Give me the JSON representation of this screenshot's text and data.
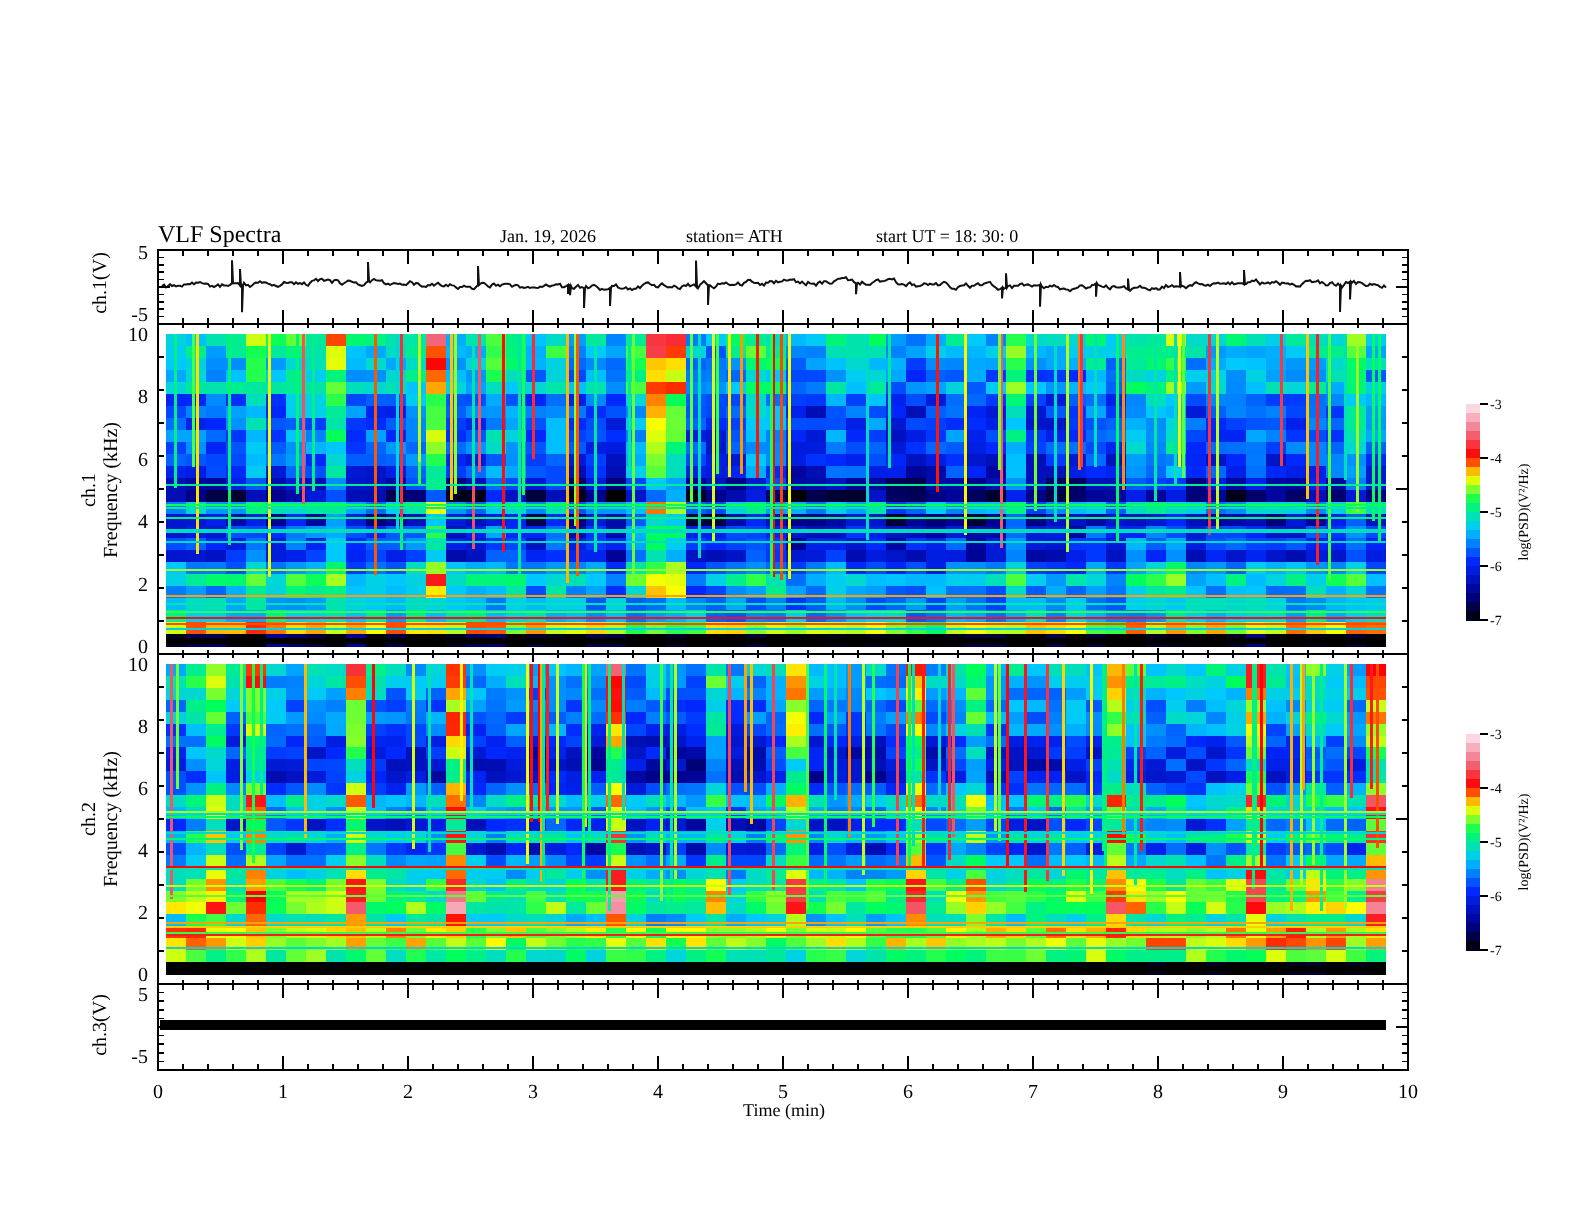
{
  "header": {
    "title": "VLF  Spectra",
    "date": "Jan.  19,  2026",
    "station": "station= ATH",
    "start": "start  UT  =   18: 30: 0"
  },
  "panels": [
    {
      "kind": "waveform",
      "ylabel": [
        "ch.1(V)"
      ],
      "yticks": [
        "5",
        "-5"
      ]
    },
    {
      "kind": "spectrogram",
      "ylabel": [
        "ch.1",
        "Frequency  (kHz)"
      ],
      "yticks": [
        "10",
        "8",
        "6",
        "4",
        "2",
        "0"
      ],
      "colorbar": {
        "ticks": [
          "-3",
          "-4",
          "-5",
          "-6",
          "-7"
        ],
        "label": "log(PSD)(V²/Hz)"
      }
    },
    {
      "kind": "spectrogram",
      "ylabel": [
        "ch.2",
        "Frequency  (kHz)"
      ],
      "yticks": [
        "10",
        "8",
        "6",
        "4",
        "2",
        "0"
      ],
      "colorbar": {
        "ticks": [
          "-3",
          "-4",
          "-5",
          "-6",
          "-7"
        ],
        "label": "log(PSD)(V²/Hz)"
      }
    },
    {
      "kind": "flatline",
      "ylabel": [
        "ch.3(V)"
      ],
      "yticks": [
        "5",
        "-5"
      ]
    }
  ],
  "xaxis": {
    "ticks": [
      "0",
      "1",
      "2",
      "3",
      "4",
      "5",
      "6",
      "7",
      "8",
      "9",
      "10"
    ],
    "label": "Time  (min)"
  }
}
